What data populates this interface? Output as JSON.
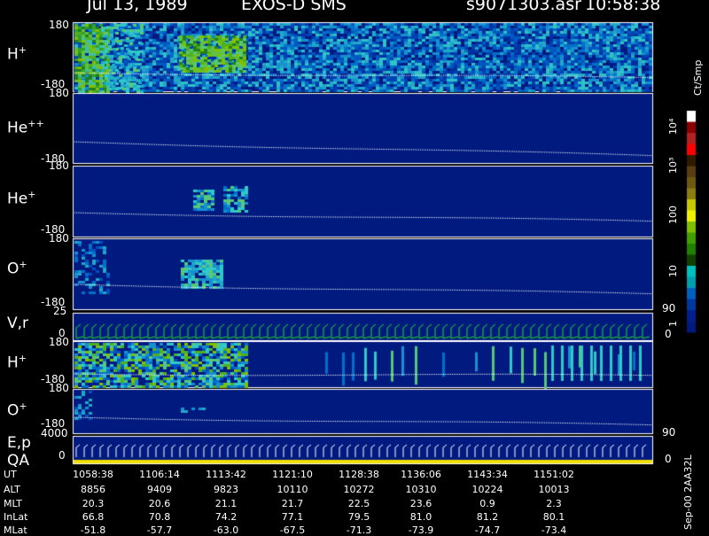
{
  "header": {
    "date": "Jul 13, 1989",
    "instrument": "EXOS-D SMS",
    "file": "s9071303.asr",
    "time": "10:58:38"
  },
  "panels": [
    {
      "id": "hplus",
      "label": "H",
      "sup": "+",
      "top_tick": "180",
      "bottom_tick": "-180"
    },
    {
      "id": "hepp",
      "label": "He",
      "sup": "++",
      "top_tick": "180",
      "bottom_tick": "-180"
    },
    {
      "id": "heplus",
      "label": "He",
      "sup": "+",
      "top_tick": "180",
      "bottom_tick": "-180"
    },
    {
      "id": "oplus",
      "label": "O",
      "sup": "+",
      "top_tick": "180",
      "bottom_tick": "-180",
      "right_tick": "90"
    },
    {
      "id": "vr",
      "label": "V,r",
      "sup": "",
      "top_tick": "25",
      "bottom_tick": "0",
      "right_tick": "0"
    },
    {
      "id": "hplus2",
      "label": "H",
      "sup": "+",
      "top_tick": "180",
      "bottom_tick": "-180"
    },
    {
      "id": "oplus2",
      "label": "O",
      "sup": "+",
      "top_tick": "180",
      "bottom_tick": "-180",
      "right_tick": "90"
    },
    {
      "id": "ep",
      "label": "E,p",
      "sup": "",
      "top_tick": "4000",
      "bottom_tick": "0",
      "right_tick": "0",
      "label2": "QA"
    }
  ],
  "colorbar": {
    "unit": "Ct/Smp",
    "labels": [
      "10⁴",
      "10³",
      "100",
      "10",
      "1"
    ],
    "colors": [
      "#ffffff",
      "#8b0000",
      "#b22222",
      "#ff0000",
      "#2e1b00",
      "#5a3d10",
      "#6b5a10",
      "#8b7d10",
      "#c8c800",
      "#f0f000",
      "#80c000",
      "#40a000",
      "#208000",
      "#104000",
      "#00c0c0",
      "#00a0b0",
      "#0060c0",
      "#0038a0",
      "#002090",
      "#001a80"
    ]
  },
  "ephemeris": {
    "rows": [
      {
        "label": "UT",
        "values": [
          "1058:38",
          "1106:14",
          "1113:42",
          "1121:10",
          "1128:38",
          "1136:06",
          "1143:34",
          "1151:02"
        ]
      },
      {
        "label": "ALT",
        "values": [
          "8856",
          "9409",
          "9823",
          "10110",
          "10272",
          "10310",
          "10224",
          "10013"
        ]
      },
      {
        "label": "MLT",
        "values": [
          "20.3",
          "20.6",
          "21.1",
          "21.7",
          "22.5",
          "23.6",
          "0.9",
          "2.3"
        ]
      },
      {
        "label": "InLat",
        "values": [
          "66.8",
          "70.8",
          "74.2",
          "77.1",
          "79.5",
          "81.0",
          "81.2",
          "80.1"
        ]
      },
      {
        "label": "MLat",
        "values": [
          "-51.8",
          "-57.7",
          "-63.0",
          "-67.5",
          "-71.3",
          "-73.9",
          "-74.7",
          "-73.4"
        ]
      }
    ]
  },
  "footer": {
    "stamp": "Sep-00  2AA32L"
  },
  "colors": {
    "background": "#000000",
    "field_bg": "#001a80",
    "trace_white": "#ffffff",
    "trace_green": "#22dd22",
    "qa_yellow": "#f0e000"
  }
}
